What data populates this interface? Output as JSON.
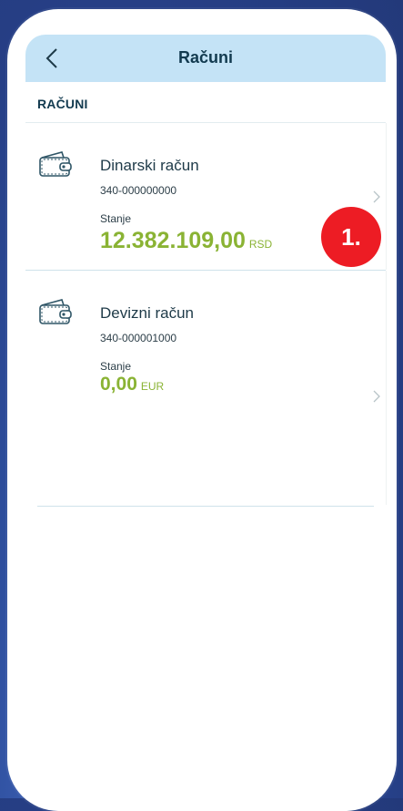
{
  "header": {
    "title": "Računi",
    "back_icon": "chevron-left-icon"
  },
  "section": {
    "label": "RAČUNI"
  },
  "accounts": [
    {
      "name": "Dinarski račun",
      "number": "340-000000000",
      "balance_label": "Stanje",
      "balance": "12.382.109,00",
      "currency": "RSD",
      "icon": "wallet-icon"
    },
    {
      "name": "Devizni račun",
      "number": "340-000001000",
      "balance_label": "Stanje",
      "balance": "0,00",
      "currency": "EUR",
      "icon": "wallet-icon"
    }
  ],
  "annotation": {
    "label": "1."
  },
  "colors": {
    "header_bg": "#c4e3f6",
    "amount": "#8ab334",
    "badge": "#ed1c24",
    "background": "#2e4f9e"
  }
}
